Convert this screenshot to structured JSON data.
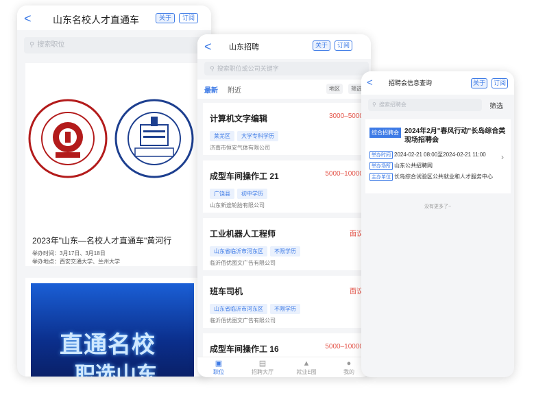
{
  "panel1": {
    "back": "<",
    "title": "山东名校人才直通车",
    "about": "关于",
    "subscribe": "订阅",
    "search_placeholder": "搜索职位",
    "card_title": "2023年\"山东—名校人才直通车\"黄河行",
    "time_line": "举办时间：3月17日、3月18日",
    "place_line": "举办地点：西安交通大学、兰州大学",
    "banner_line1": "直通名校",
    "banner_line2": "职选山东"
  },
  "panel2": {
    "back": "<",
    "title": "山东招聘",
    "about": "关于",
    "subscribe": "订阅",
    "search_placeholder": "搜索职位或公司关键字",
    "tab_latest": "最新",
    "tab_nearby": "附近",
    "filter_area": "地区",
    "filter_screen": "筛选",
    "jobs": [
      {
        "title": "计算机文字编辑",
        "salary": "3000–5000",
        "tags": [
          "莱芜区",
          "大学专科学历"
        ],
        "company": "济南市恒安气体有限公司"
      },
      {
        "title": "成型车间操作工 21",
        "salary": "5000–10000",
        "tags": [
          "广饶县",
          "初中学历"
        ],
        "company": "山东新途轮胎有限公司"
      },
      {
        "title": "工业机器人工程师",
        "salary": "面议",
        "tags": [
          "山东省临沂市河东区",
          "不限学历"
        ],
        "company": "临沂佰优图文广告有限公司"
      },
      {
        "title": "班车司机",
        "salary": "面议",
        "tags": [
          "山东省临沂市河东区",
          "不限学历"
        ],
        "company": "临沂佰优图文广告有限公司"
      },
      {
        "title": "成型车间操作工 16",
        "salary": "5000–10000",
        "tags": [],
        "company": ""
      }
    ],
    "tabbar": [
      "职位",
      "招聘大厅",
      "就业E图",
      "我的"
    ]
  },
  "panel3": {
    "back": "<",
    "title": "招聘会信息查询",
    "about": "关于",
    "subscribe": "订阅",
    "search_placeholder": "搜索招聘会",
    "screen": "筛选",
    "fair_tag": "综合招聘会",
    "fair_title": "2024年2月\"春风行动\"长岛综合类现场招聘会",
    "time_label": "举办时间",
    "time_value": "2024-02-21 08:00至2024-02-21 11:00",
    "place_label": "举办场所",
    "place_value": "山东公共招聘网",
    "host_label": "主办单位",
    "host_value": "长岛综合试验区公共就业和人才服务中心",
    "no_more": "没有更多了~"
  },
  "colors": {
    "accent": "#3e7be6",
    "salary": "#e4554a"
  }
}
